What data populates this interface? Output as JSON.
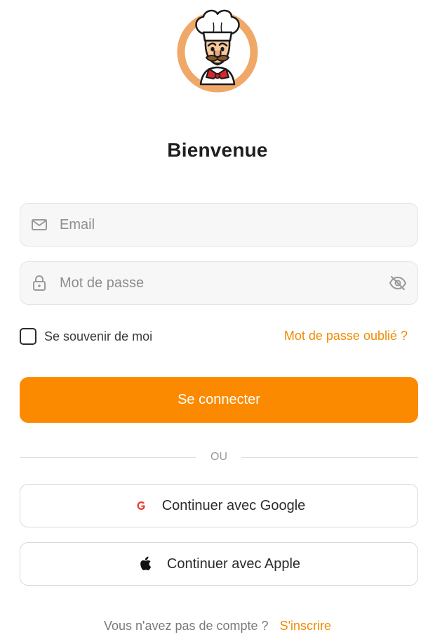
{
  "header": {
    "title": "Bienvenue"
  },
  "login": {
    "email_placeholder": "Email",
    "password_placeholder": "Mot de passe",
    "remember_label": "Se souvenir de moi",
    "remember_checked": false,
    "forgot_label": "Mot de passe oublié ?",
    "submit_label": "Se connecter"
  },
  "divider": {
    "label": "OU"
  },
  "social": {
    "google_label": "Continuer avec Google",
    "apple_label": "Continuer avec Apple"
  },
  "footer": {
    "prompt": "Vous n'avez pas de compte ?",
    "signup_label": "S'inscrire"
  },
  "icons": {
    "email": "envelope-icon",
    "password": "lock-icon",
    "visibility": "eye-off-icon",
    "google": "google-icon",
    "apple": "apple-icon"
  },
  "colors": {
    "accent": "#fb8a00",
    "link": "#f28a00",
    "field_bg": "#f7f7f7",
    "google_red": "#ea3a2e"
  }
}
